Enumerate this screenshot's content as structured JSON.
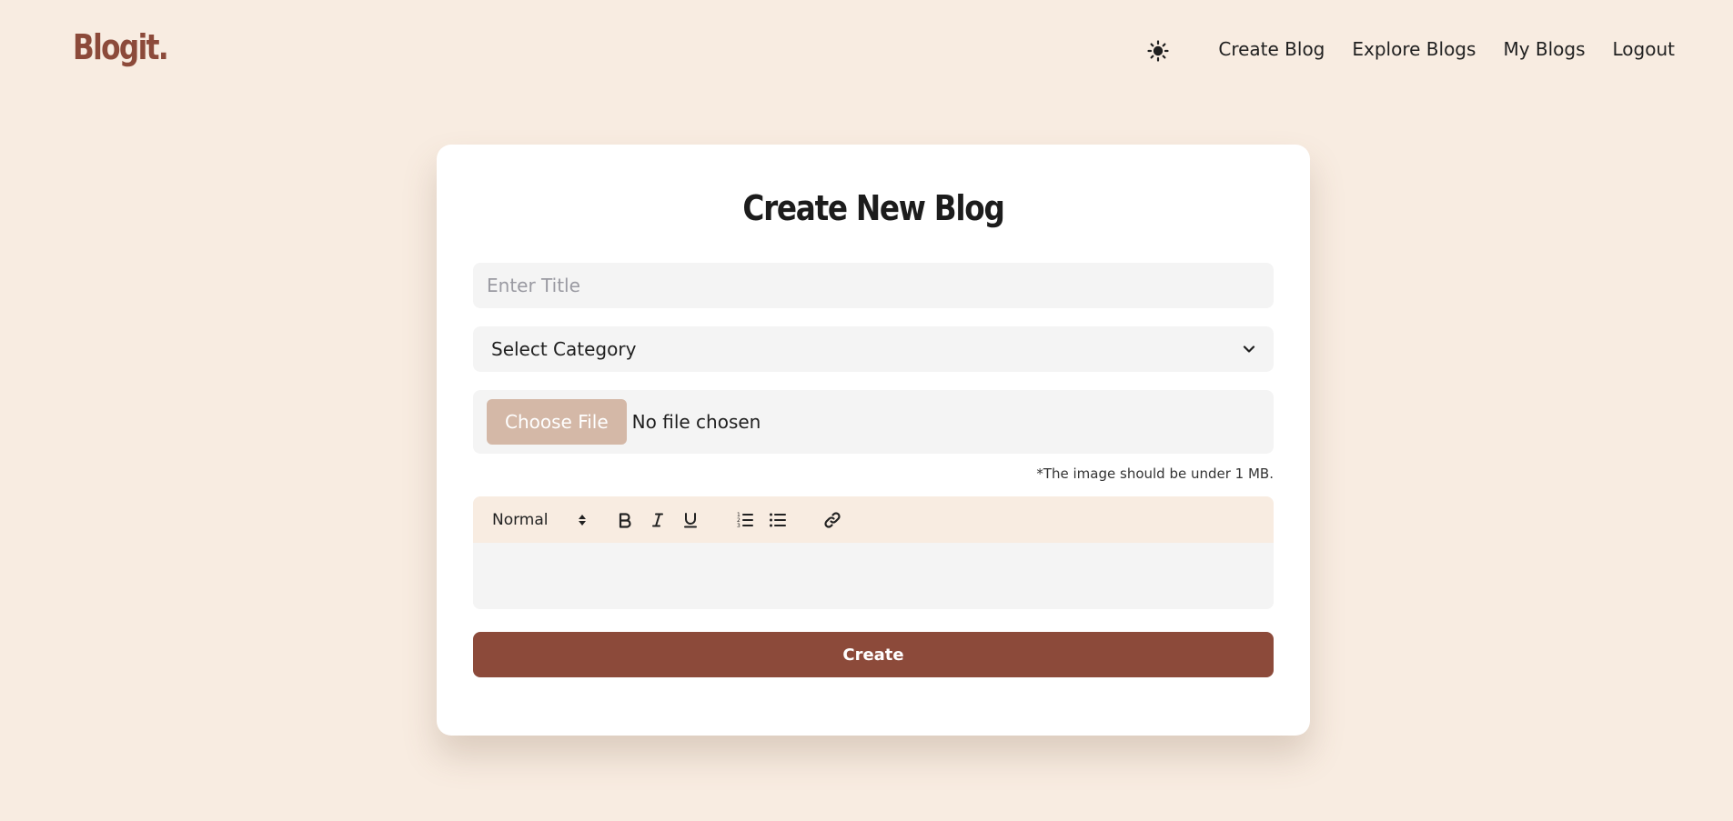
{
  "header": {
    "logo": "Blogit.",
    "theme_icon": "sun-icon",
    "nav": [
      "Create Blog",
      "Explore Blogs",
      "My Blogs",
      "Logout"
    ]
  },
  "form": {
    "heading": "Create New Blog",
    "title_placeholder": "Enter Title",
    "title_value": "",
    "category_selected": "Select Category",
    "file_button": "Choose File",
    "file_status": "No file chosen",
    "image_note": "*The image should be under 1 MB.",
    "editor": {
      "format_selected": "Normal",
      "tools": [
        "bold-icon",
        "italic-icon",
        "underline-icon",
        "ordered-list-icon",
        "bullet-list-icon",
        "link-icon"
      ],
      "content": ""
    },
    "submit": "Create"
  },
  "colors": {
    "background": "#f8ece1",
    "brand": "#8c4a3a",
    "card": "#ffffff",
    "field": "#f4f4f4",
    "file_button": "#d4b8a7"
  }
}
